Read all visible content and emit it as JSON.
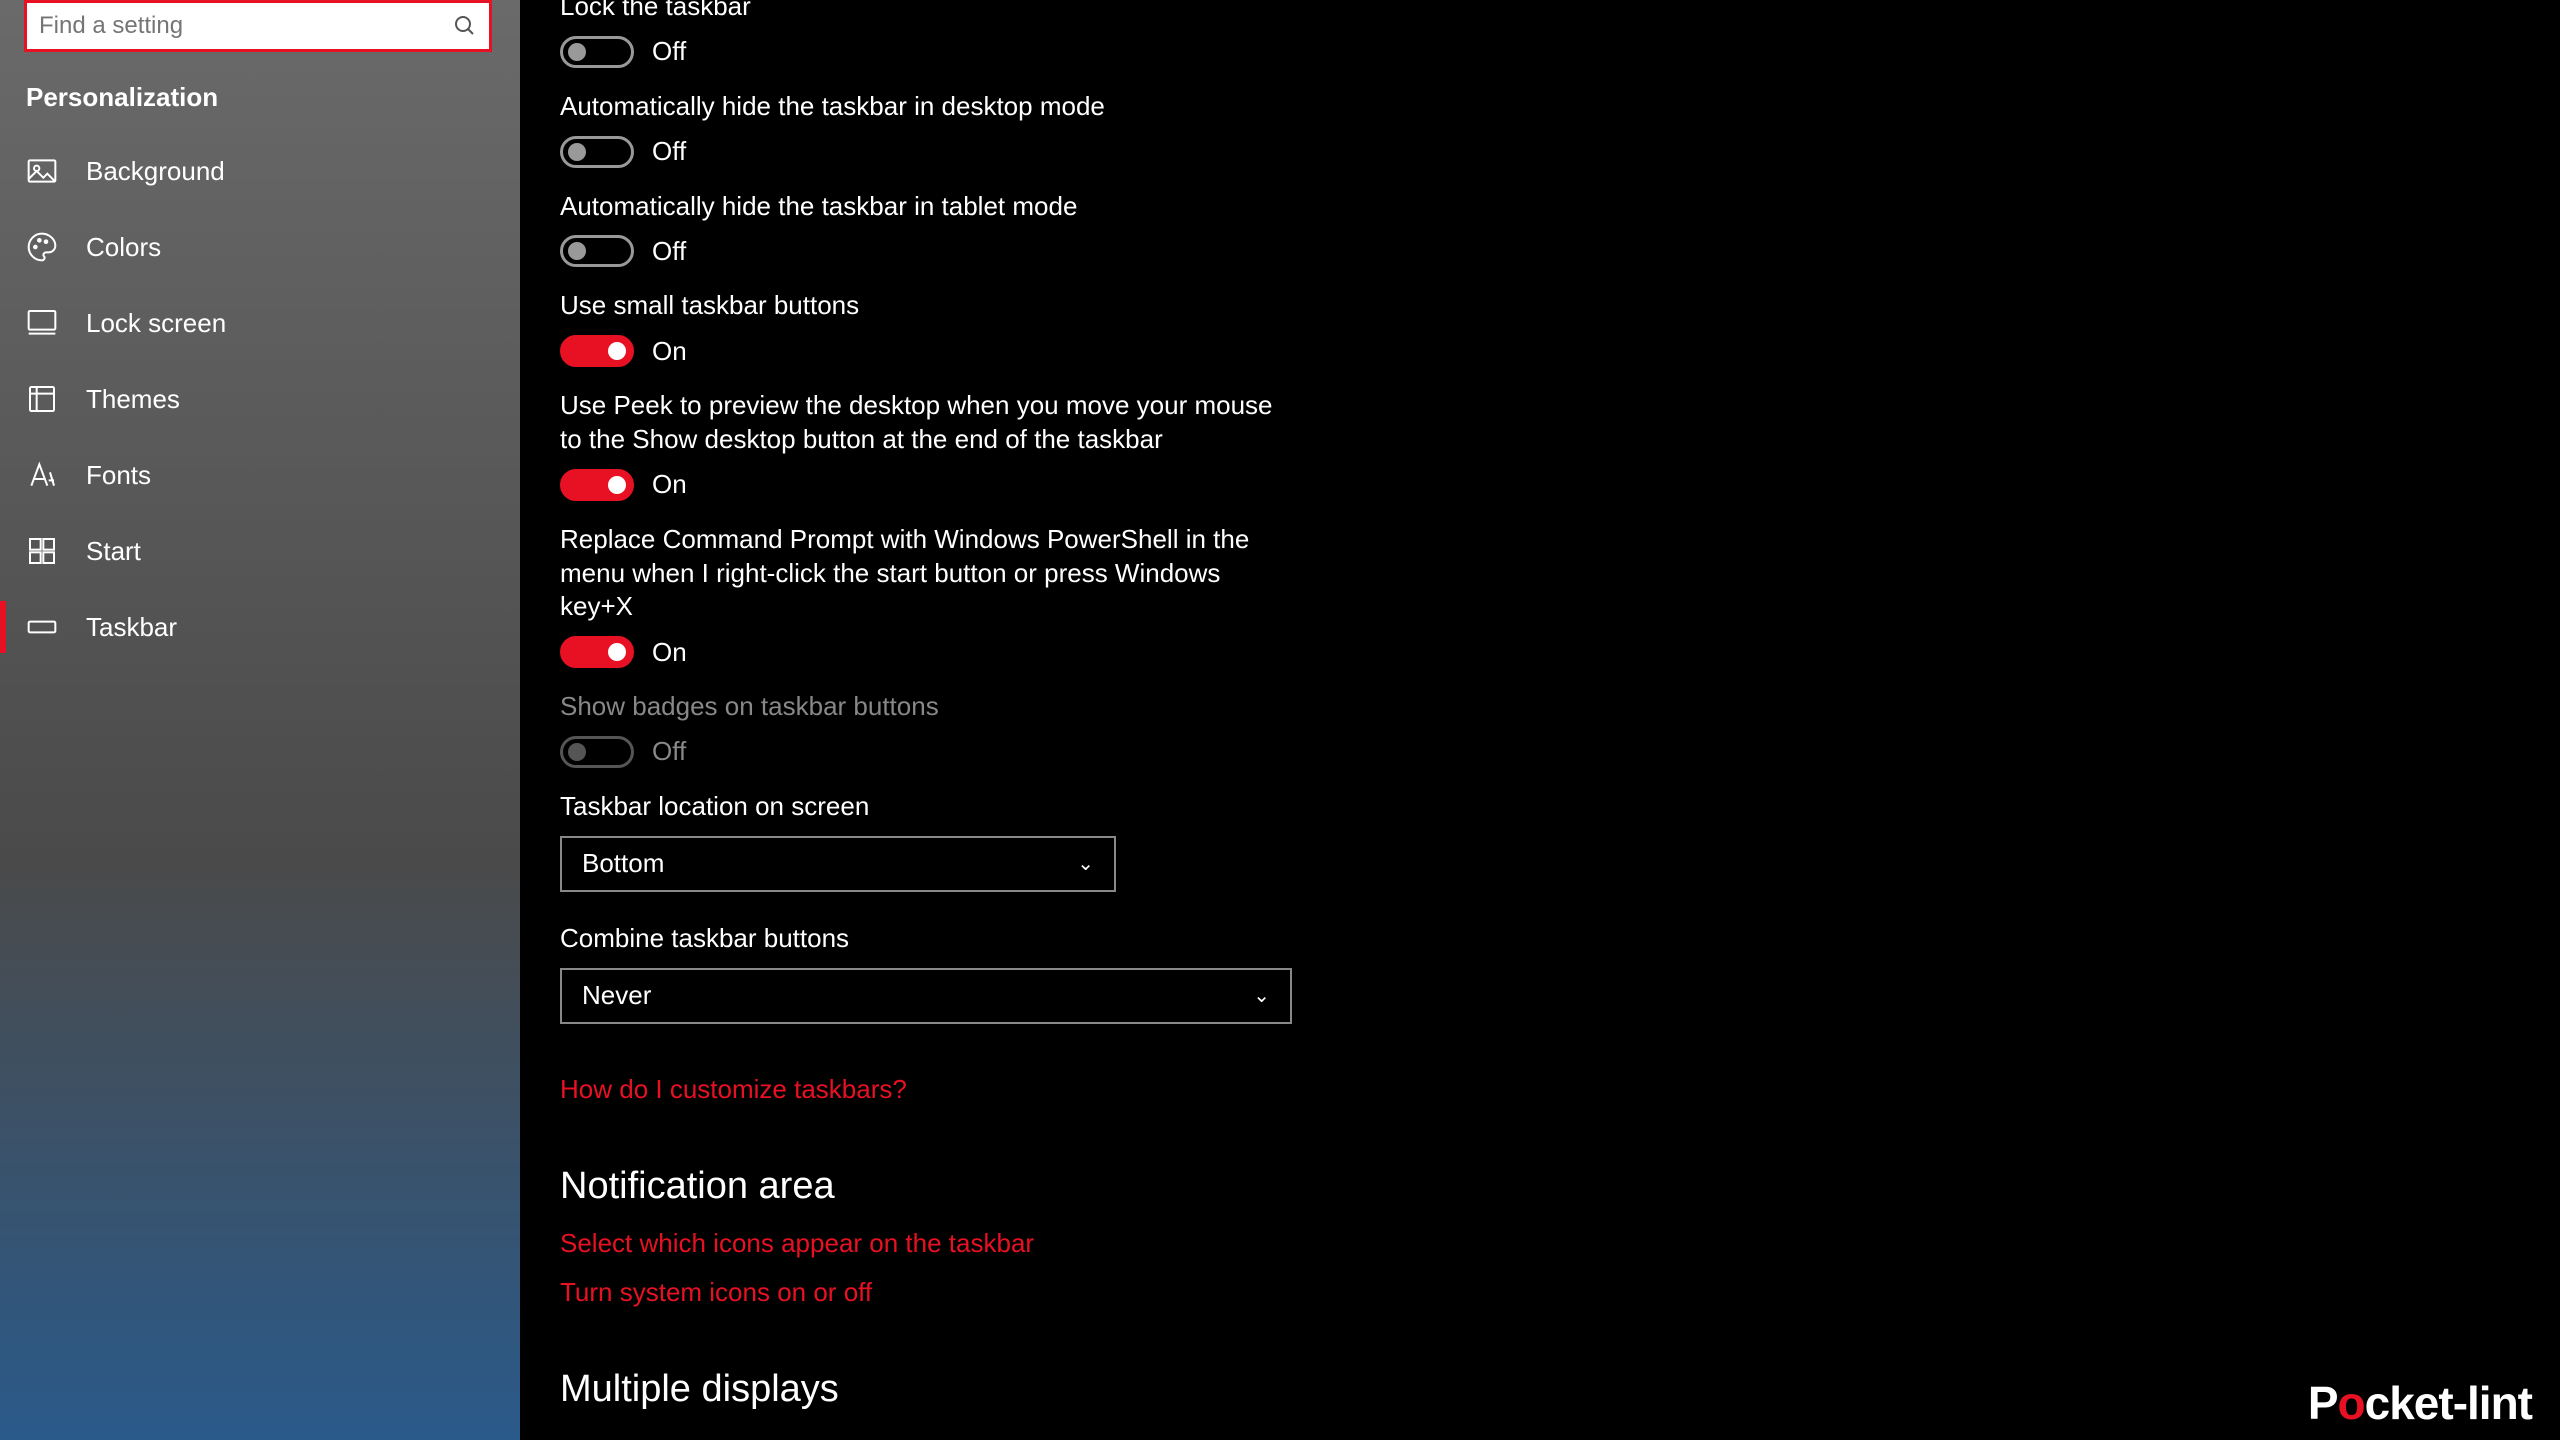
{
  "search": {
    "placeholder": "Find a setting"
  },
  "section": "Personalization",
  "nav": [
    {
      "label": "Background"
    },
    {
      "label": "Colors"
    },
    {
      "label": "Lock screen"
    },
    {
      "label": "Themes"
    },
    {
      "label": "Fonts"
    },
    {
      "label": "Start"
    },
    {
      "label": "Taskbar"
    }
  ],
  "settings": {
    "lock": {
      "label": "Lock the taskbar",
      "state": "Off"
    },
    "hide_desktop": {
      "label": "Automatically hide the taskbar in desktop mode",
      "state": "Off"
    },
    "hide_tablet": {
      "label": "Automatically hide the taskbar in tablet mode",
      "state": "Off"
    },
    "small_buttons": {
      "label": "Use small taskbar buttons",
      "state": "On"
    },
    "peek": {
      "label": "Use Peek to preview the desktop when you move your mouse to the Show desktop button at the end of the taskbar",
      "state": "On"
    },
    "powershell": {
      "label": "Replace Command Prompt with Windows PowerShell in the menu when I right-click the start button or press Windows key+X",
      "state": "On"
    },
    "badges": {
      "label": "Show badges on taskbar buttons",
      "state": "Off"
    },
    "location": {
      "label": "Taskbar location on screen",
      "value": "Bottom"
    },
    "combine": {
      "label": "Combine taskbar buttons",
      "value": "Never"
    }
  },
  "links": {
    "customize": "How do I customize taskbars?",
    "select_icons": "Select which icons appear on the taskbar",
    "system_icons": "Turn system icons on or off"
  },
  "headings": {
    "notification": "Notification area",
    "multiple": "Multiple displays"
  },
  "watermark": {
    "p1": "P",
    "pw": "o",
    "p2": "cket-lint"
  }
}
